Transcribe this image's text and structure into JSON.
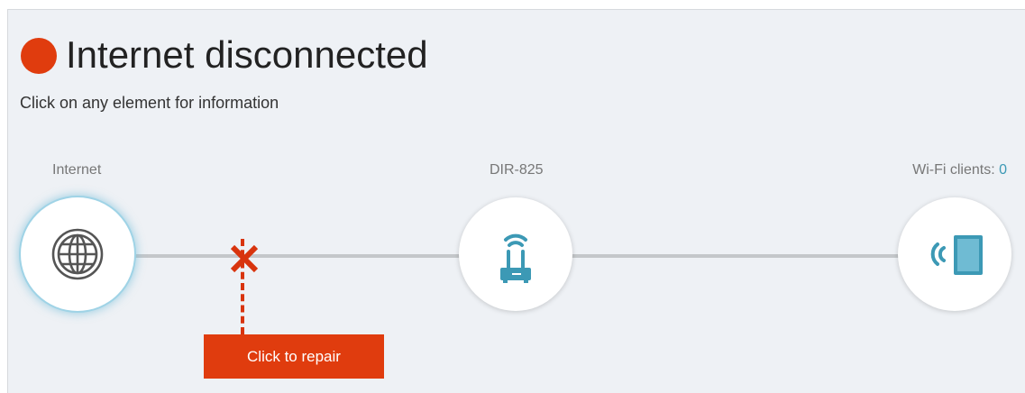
{
  "status": {
    "title": "Internet disconnected",
    "indicator_color": "#e03c0e"
  },
  "hint": "Click on any element for information",
  "nodes": {
    "internet": {
      "label": "Internet",
      "icon": "globe-icon"
    },
    "router": {
      "label": "DIR-825",
      "icon": "router-icon"
    },
    "wifi": {
      "label": "Wi-Fi clients: ",
      "count": "0",
      "icon": "tablet-wifi-icon"
    }
  },
  "connection": {
    "internet_link": "failed",
    "failure_icon": "x-mark-icon"
  },
  "repair_button": {
    "label": "Click to repair"
  },
  "colors": {
    "accent": "#3c99b5",
    "error": "#e03c0e",
    "line": "#c4c7ca",
    "background": "#eef1f5"
  }
}
